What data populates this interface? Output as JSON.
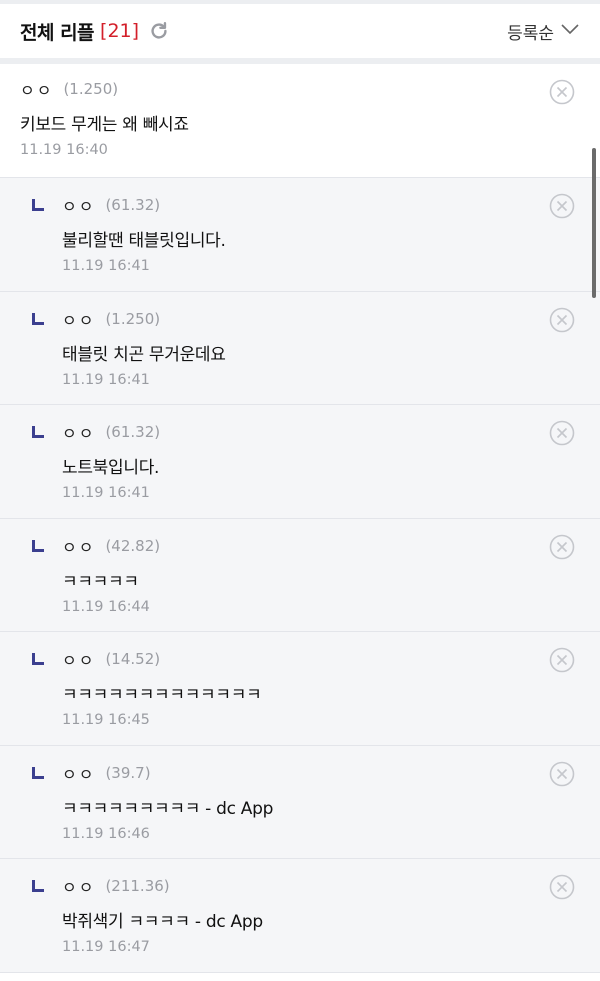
{
  "header": {
    "title": "전체 리플",
    "count": "[21]",
    "sort_label": "등록순"
  },
  "comments": [
    {
      "type": "parent",
      "nick": "ㅇㅇ",
      "ip": "(1.250)",
      "content": "키보드 무게는 왜 빼시죠",
      "date": "11.19 16:40"
    },
    {
      "type": "reply",
      "nick": "ㅇㅇ",
      "ip": "(61.32)",
      "content": "불리할땐 태블릿입니다.",
      "date": "11.19 16:41"
    },
    {
      "type": "reply",
      "nick": "ㅇㅇ",
      "ip": "(1.250)",
      "content": "태블릿 치곤 무거운데요",
      "date": "11.19 16:41"
    },
    {
      "type": "reply",
      "nick": "ㅇㅇ",
      "ip": "(61.32)",
      "content": "노트북입니다.",
      "date": "11.19 16:41"
    },
    {
      "type": "reply",
      "nick": "ㅇㅇ",
      "ip": "(42.82)",
      "content": "ㅋㅋㅋㅋㅋ",
      "date": "11.19 16:44"
    },
    {
      "type": "reply",
      "nick": "ㅇㅇ",
      "ip": "(14.52)",
      "content": "ㅋㅋㅋㅋㅋㅋㅋㅋㅋㅋㅋㅋㅋ",
      "date": "11.19 16:45"
    },
    {
      "type": "reply",
      "nick": "ㅇㅇ",
      "ip": "(39.7)",
      "content": "ㅋㅋㅋㅋㅋㅋㅋㅋㅋ - dc App",
      "date": "11.19 16:46"
    },
    {
      "type": "reply",
      "nick": "ㅇㅇ",
      "ip": "(211.36)",
      "content": "박쥐색기 ㅋㅋㅋㅋ - dc App",
      "date": "11.19 16:47"
    }
  ],
  "colors": {
    "count_red": "#d31f2a",
    "reply_bg": "#f5f6f8",
    "reply_mark": "#3b3f8f",
    "muted": "#9a9ca2"
  }
}
